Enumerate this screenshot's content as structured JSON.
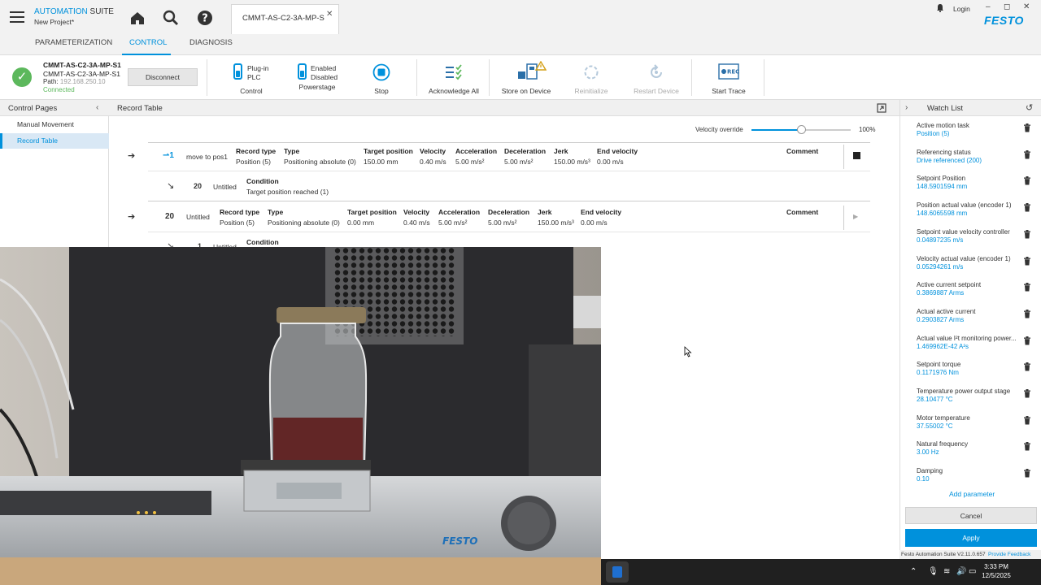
{
  "app": {
    "brand_primary": "AUTOMATION",
    "brand_secondary": "SUITE",
    "project": "New Project*",
    "doc_tab": "CMMT-AS-C2-3A-MP-S",
    "login": "Login",
    "logo": "FESTO",
    "accent_color": "#0091dc"
  },
  "menu": {
    "tabs": [
      "PARAMETERIZATION",
      "CONTROL",
      "DIAGNOSIS"
    ],
    "active": "CONTROL"
  },
  "device": {
    "name1": "CMMT-AS-C2-3A-MP-S1",
    "name2": "CMMT-AS-C2-3A-MP-S1",
    "path_label": "Path:",
    "path_value": "192.168.250.10",
    "status": "Connected",
    "disconnect": "Disconnect"
  },
  "toolbar": {
    "plugin": "Plug-in",
    "plc": "PLC",
    "control": "Control",
    "enabled": "Enabled",
    "disabled": "Disabled",
    "powerstage": "Powerstage",
    "stop": "Stop",
    "acknowledge": "Acknowledge All",
    "store": "Store on Device",
    "reinitialize": "Reinitialize",
    "restart": "Restart Device",
    "trace": "Start Trace"
  },
  "left_panel": {
    "title": "Control Pages",
    "items": [
      "Manual Movement",
      "Record Table"
    ],
    "active": "Record Table"
  },
  "center": {
    "title": "Record Table",
    "velocity_label": "Velocity override",
    "velocity_pct": "100%",
    "velocity_value": 0.5
  },
  "records": {
    "headers": {
      "record_type": "Record type",
      "type": "Type",
      "target": "Target position",
      "velocity": "Velocity",
      "acceleration": "Acceleration",
      "deceleration": "Deceleration",
      "jerk": "Jerk",
      "end_velocity": "End velocity",
      "comment": "Comment",
      "condition": "Condition"
    },
    "r1": {
      "num": "1",
      "name": "move to pos1",
      "record_type": "Position (5)",
      "type": "Positioning absolute (0)",
      "target": "150.00 mm",
      "velocity": "0.40 m/s",
      "acceleration": "5.00 m/s²",
      "deceleration": "5.00 m/s²",
      "jerk": "150.00 m/s³",
      "end_velocity": "0.00 m/s"
    },
    "c1": {
      "num": "20",
      "name": "Untitled",
      "condition": "Target position reached (1)"
    },
    "r2": {
      "num": "20",
      "name": "Untitled",
      "record_type": "Position (5)",
      "type": "Positioning absolute (0)",
      "target": "0.00 mm",
      "velocity": "0.40 m/s",
      "acceleration": "5.00 m/s²",
      "deceleration": "5.00 m/s²",
      "jerk": "150.00 m/s³",
      "end_velocity": "0.00 m/s"
    },
    "c2": {
      "num": "1",
      "name": "Untitled"
    }
  },
  "watch_list": {
    "title": "Watch List",
    "items": [
      {
        "name": "Active motion task",
        "value": "Position (5)"
      },
      {
        "name": "Referencing status",
        "value": "Drive referenced (200)"
      },
      {
        "name": "Setpoint Position",
        "value": "148.5901594 mm"
      },
      {
        "name": "Position actual value (encoder 1)",
        "value": "148.6065598 mm"
      },
      {
        "name": "Setpoint value velocity controller",
        "value": "0.04897235 m/s"
      },
      {
        "name": "Velocity actual value (encoder 1)",
        "value": "0.05294261 m/s"
      },
      {
        "name": "Active current setpoint",
        "value": "0.3869887 Arms"
      },
      {
        "name": "Actual active current",
        "value": "0.2903827 Arms"
      },
      {
        "name": "Actual value I²t monitoring power...",
        "value": "1.469962E-42 A²s"
      },
      {
        "name": "Setpoint torque",
        "value": "0.1171976 Nm"
      },
      {
        "name": "Temperature power output stage",
        "value": "28.10477 °C"
      },
      {
        "name": "Motor temperature",
        "value": "37.55002 °C"
      },
      {
        "name": "Natural frequency",
        "value": "3.00 Hz"
      },
      {
        "name": "Damping",
        "value": "0.10"
      }
    ],
    "add": "Add parameter",
    "cancel": "Cancel",
    "apply": "Apply"
  },
  "statusbar": {
    "version": "Festo Automation Suite V2.11.0.657",
    "feedback": "Provide Feedback"
  },
  "photo": {
    "label": "FESTO"
  },
  "taskbar": {
    "time": "3:33 PM",
    "date": "12/5/2025"
  }
}
